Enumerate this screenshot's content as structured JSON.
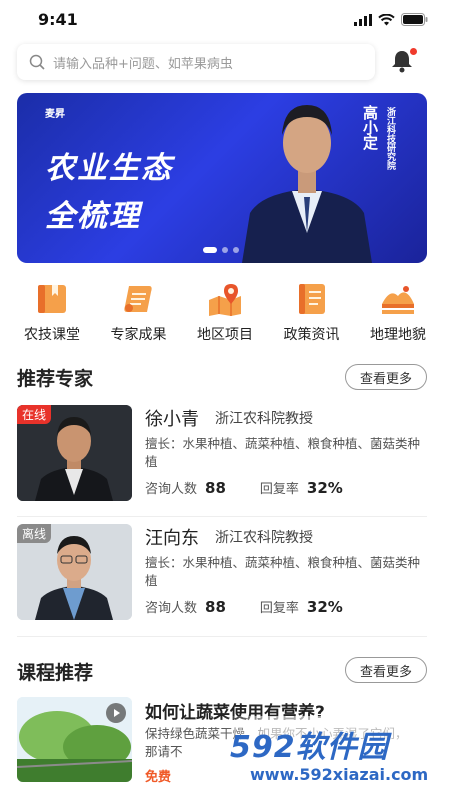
{
  "status_bar": {
    "time": "9:41"
  },
  "search": {
    "placeholder": "请输入品种+问题、如苹果病虫"
  },
  "banner": {
    "brand": "麦昇",
    "headline_line1": "农业生态",
    "headline_line2": "全梳理",
    "person_name": "高小定",
    "organization": "浙江科技研究院",
    "carousel_total": 3,
    "carousel_active": 1
  },
  "categories": [
    {
      "label": "农技课堂",
      "icon": "book-icon"
    },
    {
      "label": "专家成果",
      "icon": "scroll-icon"
    },
    {
      "label": "地区项目",
      "icon": "map-pin-icon"
    },
    {
      "label": "政策资讯",
      "icon": "notebook-icon"
    },
    {
      "label": "地理地貌",
      "icon": "landscape-icon"
    }
  ],
  "experts_section": {
    "title": "推荐专家",
    "more_label": "查看更多"
  },
  "experts": [
    {
      "status": "在线",
      "name": "徐小青",
      "title": "浙江农科院教授",
      "skills": "擅长：水果种植、蔬菜种植、粮食种植、菌菇类种植",
      "consult_label": "咨询人数",
      "consult_count": "88",
      "reply_label": "回复率",
      "reply_rate": "32%"
    },
    {
      "status": "离线",
      "name": "汪向东",
      "title": "浙江农科院教授",
      "skills": "擅长：水果种植、蔬菜种植、粮食种植、菌菇类种植",
      "consult_label": "咨询人数",
      "consult_count": "88",
      "reply_label": "回复率",
      "reply_rate": "32%"
    }
  ],
  "courses_section": {
    "title": "课程推荐",
    "more_label": "查看更多"
  },
  "course": {
    "title": "如何让蔬菜使用有营养?",
    "description": "保持绿色蔬菜干燥，如果你不小心弄湿了它们，那请不",
    "price": "免费"
  },
  "watermark": {
    "logo": "592软件园",
    "url": "www.592xiazai.com"
  },
  "colors": {
    "accent": "#e8322a",
    "price": "#f05a28",
    "banner": "#2c3ee3",
    "icon": "#f08a3c"
  }
}
